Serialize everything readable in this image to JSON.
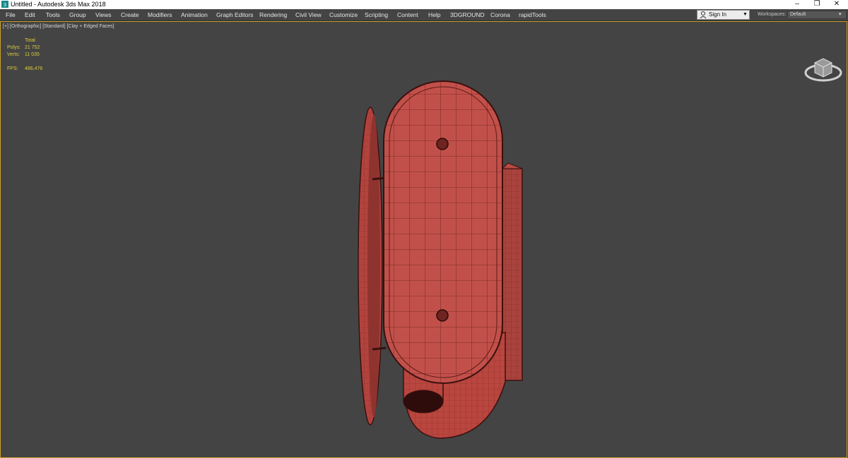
{
  "window": {
    "title": "Untitled - Autodesk 3ds Max 2018",
    "minimize_glyph": "–",
    "restore_glyph": "❐",
    "close_glyph": "✕"
  },
  "menu": [
    "File",
    "Edit",
    "Tools",
    "Group",
    "Views",
    "Create",
    "Modifiers",
    "Animation",
    "Graph Editors",
    "Rendering",
    "Civil View",
    "Customize",
    "Scripting",
    "Content",
    "Help",
    "3DGROUND",
    "Corona",
    "rapidTools"
  ],
  "account": {
    "sign_in_label": "Sign In",
    "user_icon": "user-icon"
  },
  "workspaces": {
    "label": "Workspaces:",
    "value": "Default"
  },
  "viewport": {
    "label": "[+] [Orthographic] [Standard] [Clay + Edged Faces]",
    "stats": {
      "header": "Total",
      "polys_label": "Polys:",
      "polys_value": "21 752",
      "verts_label": "Verts:",
      "verts_value": "11 035",
      "fps_label": "FPS:",
      "fps_value": "486,476"
    }
  },
  "colors": {
    "viewport_bg": "#444444",
    "active_border": "#c9a12a",
    "stats_text": "#d9cc3c",
    "model_clay": "#c2504a",
    "model_edges": "#5a1a16"
  }
}
